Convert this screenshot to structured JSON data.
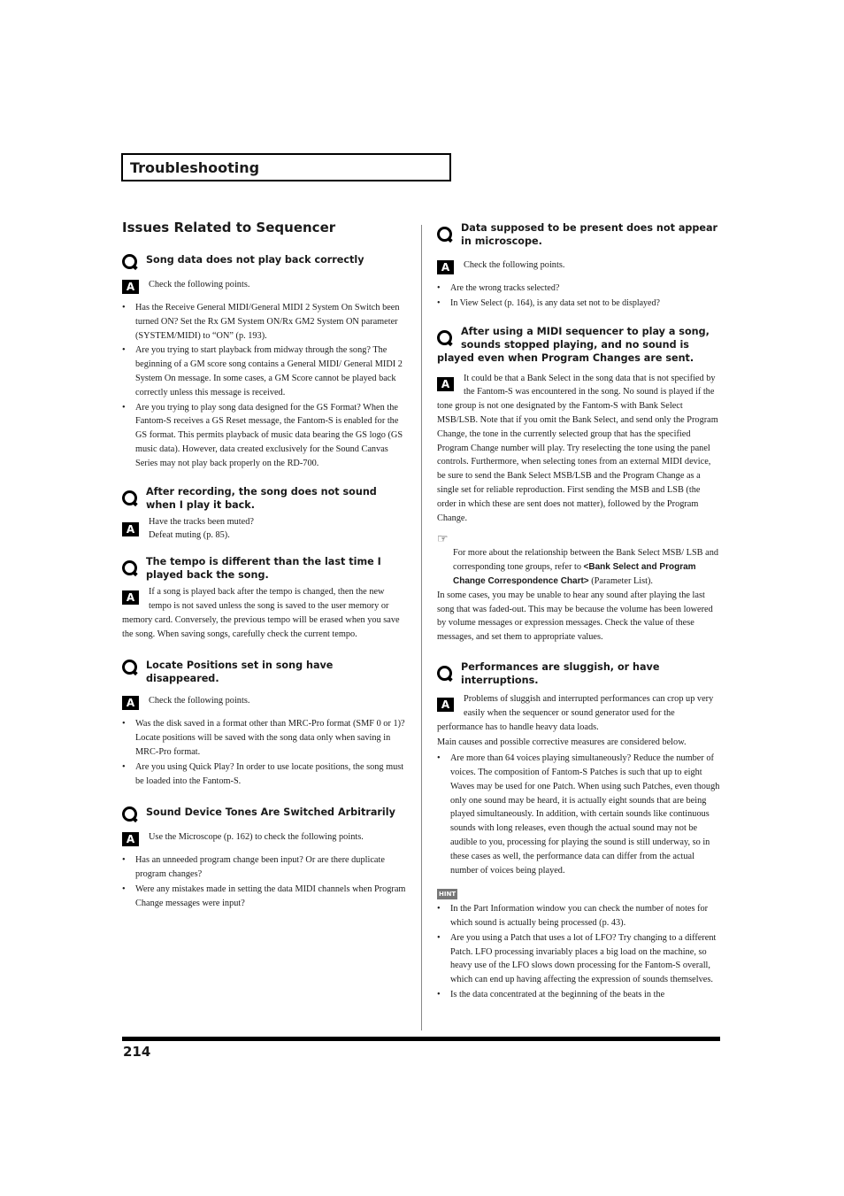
{
  "header": {
    "section_title": "Troubleshooting"
  },
  "page_number": "214",
  "left_column": {
    "heading": "Issues Related to Sequencer",
    "qa": [
      {
        "question": "Song data does not play back correctly",
        "answer": "Check the following points.",
        "bullets": [
          "Has the Receive General MIDI/General MIDI 2 System On Switch been turned ON? Set the Rx GM System ON/Rx GM2 System ON parameter (SYSTEM/MIDI) to “ON” (p. 193).",
          "Are you trying to start playback from midway through the song? The beginning of a GM score song contains a General MIDI/ General MIDI 2 System On message. In some cases, a GM Score cannot be played back correctly unless this message is received.",
          "Are you trying to play song data designed for the GS Format? When the Fantom-S receives a GS Reset message, the Fantom-S is enabled for the GS format. This permits playback of music data bearing the GS logo (GS music data). However, data created exclusively for the Sound Canvas Series may not play back properly on the RD-700."
        ]
      },
      {
        "question": "After recording, the song does not sound when I play it back.",
        "answer_lines": [
          "Have the tracks been muted?",
          "Defeat muting (p. 85)."
        ]
      },
      {
        "question": "The tempo is different than the last time I played back the song.",
        "answer": "If a song is played back after the tempo is changed, then the new tempo is not saved unless the song is saved to the user memory or memory card. Conversely, the previous tempo will be erased when you save the song. When saving songs, carefully check the current tempo."
      },
      {
        "question": "Locate Positions set in song have disappeared.",
        "answer": "Check the following points.",
        "bullets": [
          "Was the disk saved in a format other than MRC-Pro format (SMF 0 or 1)? Locate positions will be saved with the song data only when saving in MRC-Pro format.",
          "Are you using Quick Play? In order to use locate positions, the song must be loaded into the Fantom-S."
        ]
      },
      {
        "question": "Sound Device Tones Are Switched Arbitrarily",
        "answer": "Use the Microscope (p. 162) to check the following points.",
        "bullets": [
          "Has an unneeded program change been input? Or are there duplicate program changes?",
          "Were any mistakes made in setting the data MIDI channels when Program Change messages were input?"
        ]
      }
    ]
  },
  "right_column": {
    "qa": [
      {
        "question": "Data supposed to be present does not appear in microscope.",
        "answer": "Check the following points.",
        "bullets": [
          "Are the wrong tracks selected?",
          "In View Select (p. 164), is any data set not to be displayed?"
        ]
      },
      {
        "question": "After using a MIDI sequencer to play a song, sounds stopped playing, and no sound is played even when Program Changes are sent.",
        "answer": "It could be that a Bank Select in the song data that is not specified by the Fantom-S was encountered in the song. No sound is played if the tone group is not one designated by the Fantom-S with Bank Select MSB/LSB. Note that if you omit the Bank Select, and send only the Program Change, the tone in the currently selected group that has the specified Program Change number will play. Try reselecting the tone using the panel controls. Furthermore, when selecting tones from an external MIDI device, be sure to send the Bank Select MSB/LSB and the Program Change as a single set for reliable reproduction. First sending the MSB and LSB (the order in which these are sent does not matter), followed by the Program Change.",
        "reference": {
          "icon": "pointing-hand-icon",
          "text_before": "For more about the relationship between the Bank Select MSB/ LSB and corresponding tone groups, refer to ",
          "link_text": "<Bank Select and Program Change Correspondence Chart>",
          "text_after": " (Parameter List)."
        },
        "extra_paragraph": "In some cases, you may be unable to hear any sound after playing the last song that was faded-out. This may be because the volume has been lowered by volume messages or expression messages. Check the value of these messages, and set them to appropriate values."
      },
      {
        "question": "Performances are sluggish, or have interruptions.",
        "answer": "Problems of sluggish and interrupted performances can crop up very easily when the sequencer or sound generator used for the performance has to handle heavy data loads.",
        "extra_paragraph": "Main causes and possible corrective measures are considered below.",
        "bullets": [
          "Are more than 64 voices playing simultaneously? Reduce the number of voices. The composition of Fantom-S Patches is such that up to eight Waves may be used for one Patch. When using such Patches, even though only one sound may be heard, it is actually eight sounds that are being played simultaneously. In addition, with certain sounds like continuous sounds with long releases, even though the actual sound may not be audible to you, processing for playing the sound is still underway, so in these cases as well, the performance data can differ from the actual number of voices being played."
        ],
        "hint_label": "HINT",
        "hint_bullets": [
          "In the Part Information window you can check the number of notes for which sound is actually being processed (p. 43).",
          "Are you using a Patch that uses a lot of LFO? Try changing to a different Patch. LFO processing invariably places a big load on the machine, so heavy use of the LFO slows down processing for the Fantom-S overall, which can end up having affecting the expression of sounds themselves.",
          "Is the data concentrated at the beginning of the beats in the"
        ]
      }
    ]
  },
  "icons": {
    "question": "q-icon",
    "answer": "a-icon",
    "reference": "pointing-hand-icon",
    "hint": "hint-icon"
  },
  "colors": {
    "text": "#1a1a1a",
    "rule": "#000000",
    "divider": "#888888",
    "hint_bg": "#777777"
  }
}
